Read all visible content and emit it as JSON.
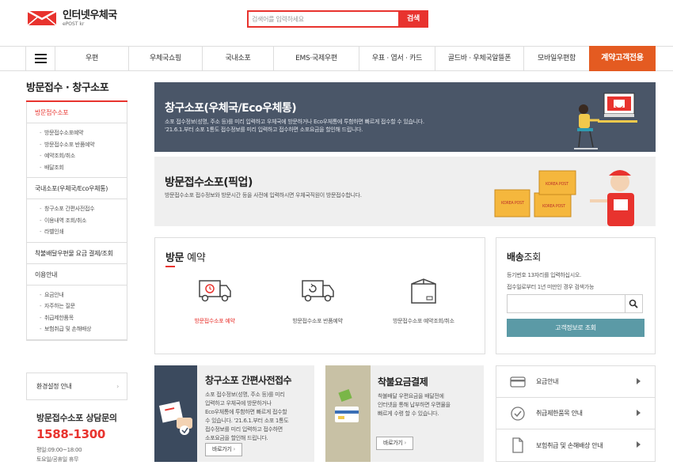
{
  "header": {
    "logo_main": "인터넷우체국",
    "logo_sub": "ePOST kr",
    "search_placeholder": "검색어를 입력하세요",
    "search_button": "검색"
  },
  "nav": {
    "items": [
      "우편",
      "우체국쇼핑",
      "국내소포",
      "EMS·국제우편",
      "우표 · 엽서 · 카드",
      "골드바 · 우체국알뜰폰",
      "모바일우편함"
    ],
    "cta": "계약고객전용"
  },
  "sidebar": {
    "title": "방문접수 · 창구소포",
    "sections": [
      {
        "label": "방문접수소포",
        "active": true,
        "sub": [
          "방문접수소포예약",
          "방문접수소포 반품예약",
          "예약조회/취소",
          "배달조회"
        ]
      },
      {
        "label": "국내소포(우체국/Eco우체통)",
        "active": false,
        "sub": [
          "창구소포 간편사전접수",
          "이용내역 조회/취소",
          "라벨인쇄"
        ]
      },
      {
        "label": "착불배달우편물 요금 결제/조회",
        "active": false,
        "sub": []
      },
      {
        "label": "이용안내",
        "active": false,
        "sub": [
          "요금안내",
          "자주하는 질문",
          "취급제한품목",
          "보험취급 및 손해배상"
        ]
      }
    ],
    "env_label": "환경설정 안내",
    "consult_title": "방문접수소포 상담문의",
    "consult_phone": "1588-1300",
    "consult_hours1": "평일:09:00~18:00",
    "consult_hours2": "토요일/공휴일 휴무"
  },
  "banner1": {
    "title": "창구소포(우체국/Eco우체통)",
    "desc1": "소포 접수정보(성명, 주소 등)를 미리 입력하고 우체국에 방문하거나 Eco우체통에 투함하면 빠르게 접수할 수 있습니다.",
    "desc2": "'21.6.1.부터 소포 1통도 접수정보를 미리 입력하고 접수하면 소포요금을 할인해 드립니다."
  },
  "banner2": {
    "title": "방문접수소포(픽업)",
    "desc": "방문접수소포 접수정보와 방문시간 등을 사전에 입력하시면 우체국직원이 방문접수합니다.",
    "box_label": "KOREA POST"
  },
  "visit": {
    "title_bold": "방문",
    "title_rest": " 예약",
    "items": [
      {
        "label": "방문접수소포 예약",
        "icon": "delivery-truck-icon",
        "highlight": true
      },
      {
        "label": "방문접수소포 반품예약",
        "icon": "return-truck-icon",
        "highlight": false
      },
      {
        "label": "방문접수소포 예약조회/취소",
        "icon": "parcel-box-icon",
        "highlight": false
      }
    ]
  },
  "tracking": {
    "title_bold": "배송",
    "title_rest": "조회",
    "desc1": "등기번호 13자리를 입력하십시오.",
    "desc2": "접수일로부터 1년 미만인 경우 검색가능",
    "button": "고객정보로 조회"
  },
  "promo1": {
    "title": "창구소포 간편사전접수",
    "desc": [
      "소포 접수정보(성명, 주소 등)를 미리",
      "입력하고 우체국에 방문하거나",
      "Eco우체통에 투함하면 빠르게 접수할",
      "수 있습니다. '21.6.1.부터 소포 1통도",
      "접수정보를 미리 입력하고 접수하면",
      "소포요금을 할인해 드립니다."
    ],
    "button": "바로가기"
  },
  "promo2": {
    "title": "착불요금결제",
    "desc": [
      "착불배달 우편요금을 배달전에",
      "인터넷을 통해 납부하면 우편물을",
      "빠르게 수령 할 수 있습니다."
    ],
    "button": "바로가기"
  },
  "quicklinks": [
    {
      "label": "요금안내",
      "icon": "card-icon"
    },
    {
      "label": "취급제한품목 안내",
      "icon": "check-circle-icon"
    },
    {
      "label": "보험취급 및 손해배상 안내",
      "icon": "document-icon"
    }
  ],
  "colors": {
    "accent": "#e8332e",
    "cta": "#e45b21",
    "banner1": "#4a5668",
    "teal": "#5b9aa6"
  }
}
